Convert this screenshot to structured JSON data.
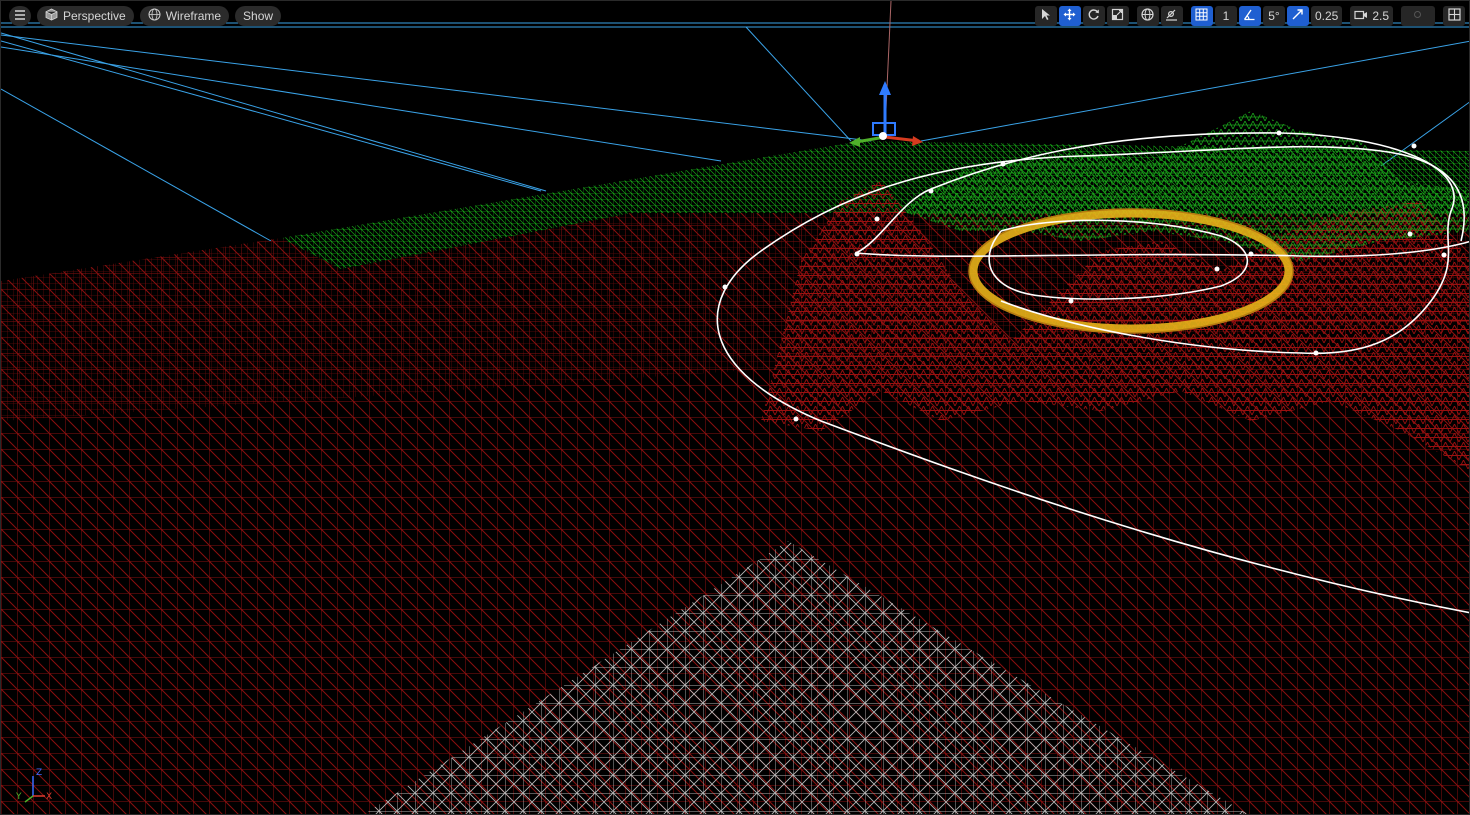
{
  "viewport": {
    "view_mode": "Perspective",
    "render_mode": "Wireframe",
    "show_label": "Show"
  },
  "toolbar_right": {
    "grid_snap_value": "1",
    "rotation_snap_value": "5°",
    "scale_snap_value": "0.25",
    "camera_speed_value": "2.5"
  },
  "axis_gizmo": {
    "x_label": "X",
    "y_label": "Y",
    "z_label": "Z"
  },
  "colors": {
    "wire_red": "#8a0f0f",
    "wire_green": "#16a316",
    "wire_white": "#b5b5b5",
    "spline": "#ffffff",
    "light_blue": "#3aa3e8",
    "accent_active": "#1f5fd1",
    "ring_yellow": "#e8b21a"
  }
}
